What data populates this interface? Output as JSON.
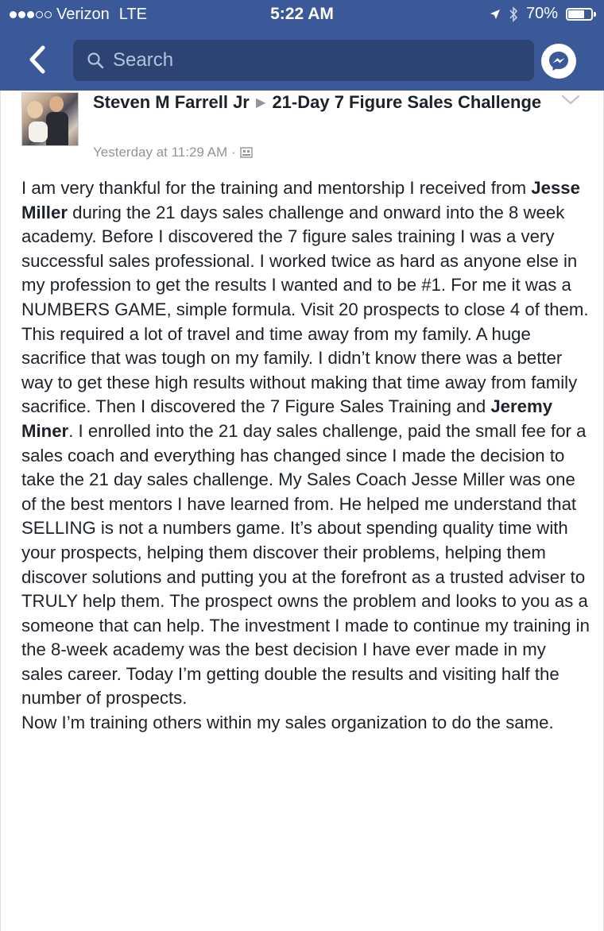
{
  "status_bar": {
    "carrier": "Verizon",
    "network": "LTE",
    "time": "5:22 AM",
    "battery_percent_label": "70%",
    "battery_level": 0.7
  },
  "nav": {
    "search_placeholder": "Search"
  },
  "post": {
    "author": "Steven M Farrell Jr",
    "group": "21-Day 7 Figure Sales Challenge",
    "timestamp": "Yesterday at 11:29 AM",
    "timestamp_sep": "·",
    "body": {
      "p1_a": "I am very thankful for the training and mentorship I received from ",
      "p1_b": "Jesse Miller",
      "p1_c": " during the 21 days sales challenge and onward into the 8 week academy. Before I discovered the 7 figure sales training I was a very successful sales professional. I worked twice as hard as anyone else in my profession to get the results I wanted and to be #1.  For me it was a NUMBERS GAME, simple formula. Visit 20 prospects to close 4 of them. This required a lot of travel and time away from my family. A huge sacrifice that was tough on my family.  I didn’t know there was a better way to get these high results without making that time away from family sacrifice. Then I discovered the 7 Figure Sales Training and ",
      "p1_d": "Jeremy Miner",
      "p1_e": ". I enrolled into the 21 day sales challenge, paid the small fee for a sales coach and everything has changed since I made the decision to take the 21 day sales challenge. My Sales Coach Jesse Miller was one of the best mentors I have learned from. He helped me understand that SELLING is not a numbers game. It’s about spending quality time with your prospects, helping them discover their problems, helping them discover solutions and putting you at the forefront as a trusted adviser to TRULY help them. The prospect owns the problem and looks to you as a someone that can help. The investment I made to continue my training in the 8-week academy was the best decision I have ever made in my sales career. Today I’m getting double the results and visiting half the number of prospects.",
      "p2": "Now I’m training others within my sales organization to do the same."
    }
  },
  "colors": {
    "facebook_blue": "#3b5998",
    "search_bg": "#2d4373",
    "meta_gray": "#90949c",
    "text": "#1d2129"
  },
  "icons": {
    "back": "chevron-left-icon",
    "search": "search-icon",
    "messenger": "messenger-icon",
    "location": "location-arrow-icon",
    "bluetooth": "bluetooth-icon",
    "battery": "battery-icon",
    "audience": "group-audience-icon",
    "post_menu": "chevron-down-icon"
  }
}
